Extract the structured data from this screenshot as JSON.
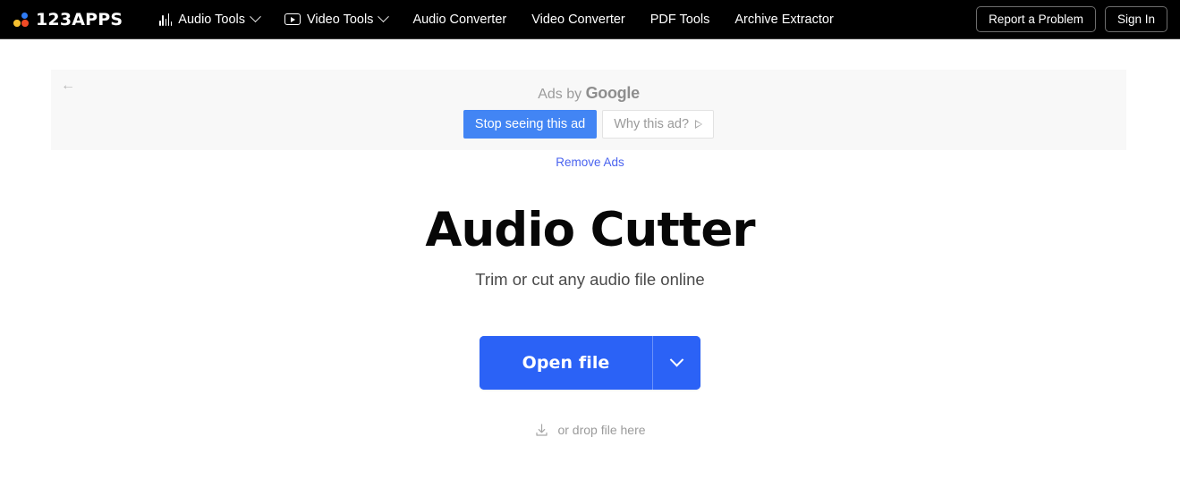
{
  "header": {
    "logo": {
      "text": "123APPS",
      "icon": "logo-dots-icon",
      "colors": {
        "blue": "#2f7cf6",
        "yellow": "#f5c030",
        "red": "#ef4a26"
      }
    },
    "nav": [
      {
        "label": "Audio Tools",
        "icon": "audio-waveform-icon",
        "has_caret": true
      },
      {
        "label": "Video Tools",
        "icon": "video-play-icon",
        "has_caret": true
      },
      {
        "label": "Audio Converter",
        "icon": null,
        "has_caret": false
      },
      {
        "label": "Video Converter",
        "icon": null,
        "has_caret": false
      },
      {
        "label": "PDF Tools",
        "icon": null,
        "has_caret": false
      },
      {
        "label": "Archive Extractor",
        "icon": null,
        "has_caret": false
      }
    ],
    "report_label": "Report a Problem",
    "signin_label": "Sign In",
    "background": "#000000"
  },
  "ad": {
    "back_icon": "arrow-left-icon",
    "ads_by_prefix": "Ads by ",
    "ads_by_brand": "Google",
    "stop_label": "Stop seeing this ad",
    "why_label": "Why this ad?",
    "why_icon": "triangle-outline-icon",
    "stop_color": "#4285f4",
    "panel_background": "#f8f8f8"
  },
  "remove_ads": {
    "label": "Remove Ads",
    "color": "#4a63ef"
  },
  "main": {
    "title": "Audio Cutter",
    "subtitle": "Trim or cut any audio file online",
    "open_file_label": "Open file",
    "dropdown_icon": "chevron-down-icon",
    "drop_text": "or drop file here",
    "drop_icon": "download-tray-icon",
    "accent_color": "#2b62f6"
  }
}
